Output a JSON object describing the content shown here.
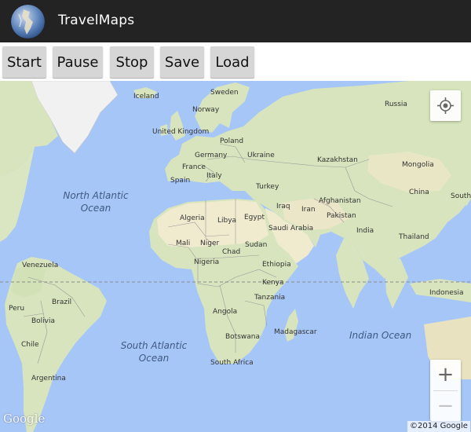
{
  "app": {
    "title": "TravelMaps"
  },
  "toolbar": {
    "start_label": "Start",
    "pause_label": "Pause",
    "stop_label": "Stop",
    "save_label": "Save",
    "load_label": "Load"
  },
  "map": {
    "labels": {
      "iceland": "Iceland",
      "sweden": "Sweden",
      "norway": "Norway",
      "russia": "Russia",
      "united_kingdom": "United Kingdom",
      "poland": "Poland",
      "germany": "Germany",
      "ukraine": "Ukraine",
      "france": "France",
      "kazakhstan": "Kazakhstan",
      "mongolia": "Mongolia",
      "italy": "Italy",
      "spain": "Spain",
      "turkey": "Turkey",
      "afghanistan": "Afghanistan",
      "iraq": "Iraq",
      "iran": "Iran",
      "china": "China",
      "south_korea_partial": "South",
      "algeria": "Algeria",
      "libya": "Libya",
      "egypt": "Egypt",
      "pakistan": "Pakistan",
      "saudi_arabia": "Saudi Arabia",
      "india": "India",
      "thailand": "Thailand",
      "mali": "Mali",
      "niger": "Niger",
      "chad": "Chad",
      "sudan": "Sudan",
      "nigeria": "Nigeria",
      "ethiopia": "Ethiopia",
      "venezuela": "Venezuela",
      "kenya": "Kenya",
      "indonesia": "Indonesia",
      "tanzania": "Tanzania",
      "peru": "Peru",
      "brazil": "Brazil",
      "angola": "Angola",
      "bolivia": "Bolivia",
      "madagascar": "Madagascar",
      "botswana": "Botswana",
      "chile": "Chile",
      "south_africa": "South Africa",
      "argentina": "Argentina",
      "north_atlantic_line1": "North Atlantic",
      "north_atlantic_line2": "Ocean",
      "south_atlantic_line1": "South Atlantic",
      "south_atlantic_line2": "Ocean",
      "indian_ocean": "Indian Ocean"
    },
    "zoom_in_symbol": "+",
    "zoom_out_symbol": "−",
    "logo_text": "Google",
    "copyright": "©2014 Google"
  },
  "colors": {
    "action_bar": "#232323",
    "water": "#a7c6f8",
    "land": "#d7e4bd",
    "desert": "#f0ebcf",
    "ice": "#f4f4f4",
    "button": "#d6d6d6"
  }
}
